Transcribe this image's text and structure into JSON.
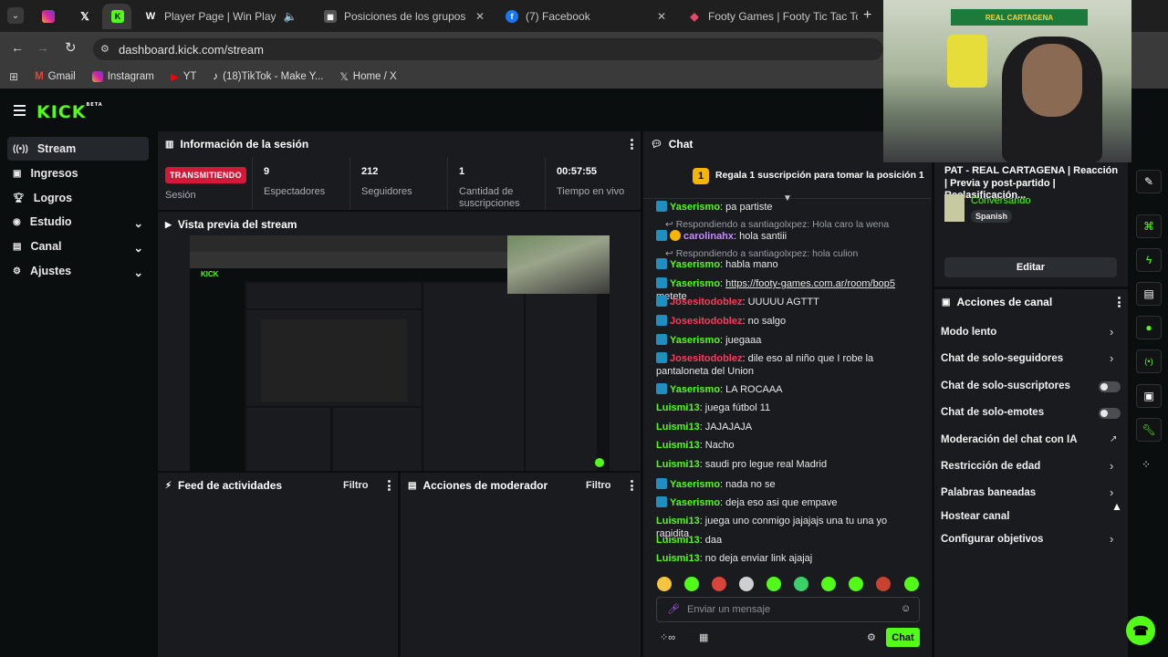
{
  "browser": {
    "tabs": [
      {
        "title": "",
        "icon": "instagram-icon"
      },
      {
        "title": "",
        "icon": "x-icon"
      },
      {
        "title": "",
        "icon": "kick-icon"
      },
      {
        "title": "Player Page | Win Play",
        "icon": "winplay-icon"
      },
      {
        "title": "Posiciones de los grupos de Tor",
        "icon": "grid-icon"
      },
      {
        "title": "(7) Facebook",
        "icon": "facebook-icon"
      },
      {
        "title": "Footy Games | Footy Tic Tac Toe",
        "icon": "footy-icon"
      }
    ],
    "url": "dashboard.kick.com/stream",
    "bookmarks": [
      "Gmail",
      "Instagram",
      "YT",
      "(18)TikTok - Make Y...",
      "Home / X"
    ]
  },
  "kick": {
    "logo": "KICK",
    "logo_sup": "BETA",
    "nav": [
      {
        "label": "Stream",
        "icon": "broadcast-icon"
      },
      {
        "label": "Ingresos",
        "icon": "wallet-icon"
      },
      {
        "label": "Logros",
        "icon": "trophy-icon"
      },
      {
        "label": "Estudio",
        "icon": "studio-icon"
      },
      {
        "label": "Canal",
        "icon": "channel-icon"
      },
      {
        "label": "Ajustes",
        "icon": "settings-icon"
      }
    ],
    "session": {
      "title": "Información de la sesión",
      "live_badge": "TRANSMITIENDO",
      "live_sub": "Sesión",
      "stats": [
        {
          "value": "9",
          "label": "Espectadores"
        },
        {
          "value": "212",
          "label": "Seguidores"
        },
        {
          "value": "1",
          "label": "Cantidad de suscripciones"
        },
        {
          "value": "00:57:55",
          "label": "Tiempo en vivo"
        }
      ]
    },
    "preview_title": "Vista previa del stream",
    "feed": {
      "title": "Feed de actividades",
      "filter": "Filtro"
    },
    "modactions": {
      "title": "Acciones de moderador",
      "filter": "Filtro"
    },
    "chat": {
      "title": "Chat",
      "pinned_rank": "1",
      "pinned": "Regala 1 suscripción para tomar la posición 1",
      "lines": [
        {
          "type": "msg",
          "user": "Yaserismo",
          "color": "#53fc18",
          "badge": true,
          "text": ": pa partiste"
        },
        {
          "type": "reply",
          "text": "Respondiendo a santiagolxpez: Hola caro la wena"
        },
        {
          "type": "msg",
          "user": "carolinahx",
          "color": "#c58cff",
          "badge": true,
          "gold": true,
          "text": ": hola santiii"
        },
        {
          "type": "reply",
          "text": "Respondiendo a santiagolxpez: hola culion"
        },
        {
          "type": "msg",
          "user": "Yaserismo",
          "color": "#53fc18",
          "badge": true,
          "text": ": habla mano"
        },
        {
          "type": "msg",
          "user": "Yaserismo",
          "color": "#53fc18",
          "badge": true,
          "text": ": ",
          "link": "https://footy-games.com.ar/room/bop5",
          "after": " metete"
        },
        {
          "type": "msg",
          "user": "Josesitodoblez",
          "color": "#ff3b5c",
          "badge": true,
          "text": ": UUUUU AGTTT"
        },
        {
          "type": "msg",
          "user": "Josesitodoblez",
          "color": "#ff3b5c",
          "badge": true,
          "text": ": no salgo"
        },
        {
          "type": "msg",
          "user": "Yaserismo",
          "color": "#53fc18",
          "badge": true,
          "text": ": juegaaa"
        },
        {
          "type": "msg2",
          "user": "Josesitodoblez",
          "color": "#ff3b5c",
          "badge": true,
          "text": ": dile eso al niño que I robe la pantaloneta del Union"
        },
        {
          "type": "msg",
          "user": "Yaserismo",
          "color": "#53fc18",
          "badge": true,
          "text": ": LA ROCAAA"
        },
        {
          "type": "msg",
          "user": "Luismi13",
          "color": "#53fc18",
          "badge": false,
          "text": ": juega fútbol 11"
        },
        {
          "type": "msg",
          "user": "Luismi13",
          "color": "#53fc18",
          "badge": false,
          "text": ": JAJAJAJA"
        },
        {
          "type": "msg",
          "user": "Luismi13",
          "color": "#53fc18",
          "badge": false,
          "text": ": Nacho"
        },
        {
          "type": "msg",
          "user": "Luismi13",
          "color": "#53fc18",
          "badge": false,
          "text": ": saudi pro legue real Madrid"
        },
        {
          "type": "msg",
          "user": "Yaserismo",
          "color": "#53fc18",
          "badge": true,
          "text": ": nada no se"
        },
        {
          "type": "msg",
          "user": "Yaserismo",
          "color": "#53fc18",
          "badge": true,
          "text": ": deja eso asi que empave"
        },
        {
          "type": "msg",
          "user": "Luismi13",
          "color": "#53fc18",
          "badge": false,
          "text": ": juega uno conmigo jajajajs una tu una yo rapidita"
        },
        {
          "type": "msg",
          "user": "Luismi13",
          "color": "#53fc18",
          "badge": false,
          "text": ": daa"
        },
        {
          "type": "msg",
          "user": "Luismi13",
          "color": "#53fc18",
          "badge": false,
          "text": ": no deja enviar link ajajaj"
        }
      ],
      "input_placeholder": "Enviar un mensaje",
      "send": "Chat"
    },
    "stream_info": {
      "title": "PAT - REAL CARTAGENA | Reacción | Previa y post-partido | Reclasificación...",
      "category": "Conversando",
      "language": "Spanish",
      "edit": "Editar"
    },
    "channel_actions": {
      "title": "Acciones de canal",
      "items": [
        {
          "label": "Modo lento",
          "control": "chevron"
        },
        {
          "label": "Chat de solo-seguidores",
          "control": "chevron"
        },
        {
          "label": "Chat de solo-suscriptores",
          "control": "toggle"
        },
        {
          "label": "Chat de solo-emotes",
          "control": "toggle"
        },
        {
          "label": "Moderación del chat con IA",
          "control": "external"
        },
        {
          "label": "Restricción de edad",
          "control": "chevron"
        },
        {
          "label": "Palabras baneadas",
          "control": "chevron"
        },
        {
          "label": "Hostear canal",
          "control": "none"
        },
        {
          "label": "Configurar objetivos",
          "control": "chevron"
        }
      ]
    },
    "webcam_banner": "REAL CARTAGENA",
    "colors": {
      "accent": "#53fc18",
      "live": "#d31939",
      "panel": "#191b1f",
      "bg": "#0b0e0f"
    }
  }
}
